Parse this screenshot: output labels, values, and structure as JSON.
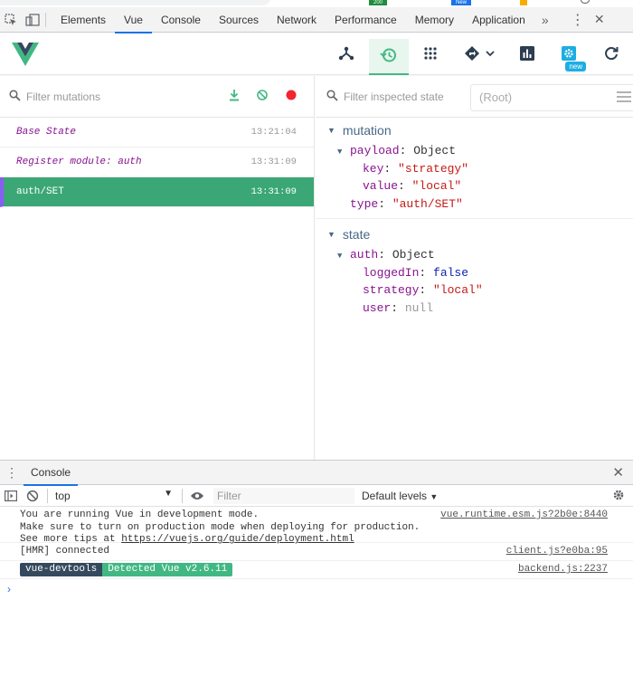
{
  "browser_badges": [
    "200",
    "New"
  ],
  "devtools": {
    "tabs": [
      {
        "label": "Elements",
        "active": false
      },
      {
        "label": "Vue",
        "active": true
      },
      {
        "label": "Console",
        "active": false
      },
      {
        "label": "Sources",
        "active": false
      },
      {
        "label": "Network",
        "active": false
      },
      {
        "label": "Performance",
        "active": false
      },
      {
        "label": "Memory",
        "active": false
      },
      {
        "label": "Application",
        "active": false
      }
    ],
    "more": "»",
    "kebab": "⋮",
    "close": "✕"
  },
  "vue_header": {
    "buttons": [
      {
        "icon": "components-tree-icon",
        "active": false
      },
      {
        "icon": "history-icon",
        "active": true
      },
      {
        "icon": "events-icon",
        "active": false
      },
      {
        "icon": "routing-icon",
        "active": false
      },
      {
        "icon": "performance-icon",
        "active": false
      },
      {
        "icon": "settings-icon",
        "active": false
      },
      {
        "icon": "refresh-icon",
        "active": false
      }
    ],
    "settings_badge": "new",
    "accent": "#42b983"
  },
  "mutations": {
    "filter_placeholder": "Filter mutations",
    "items": [
      {
        "name": "Base State",
        "time": "13:21:04",
        "selected": false
      },
      {
        "name": "Register module: auth",
        "time": "13:31:09",
        "selected": false
      },
      {
        "name": "auth/SET",
        "time": "13:31:09",
        "selected": true
      }
    ]
  },
  "inspector": {
    "filter_placeholder": "Filter inspected state",
    "root_label": "(Root)",
    "mutation_section": {
      "title": "mutation",
      "payload_key": "payload",
      "payload_type": "Object",
      "key_key": "key",
      "key_value": "\"strategy\"",
      "value_key": "value",
      "value_value": "\"local\"",
      "type_key": "type",
      "type_value": "\"auth/SET\""
    },
    "state_section": {
      "title": "state",
      "auth_key": "auth",
      "auth_type": "Object",
      "loggedIn_key": "loggedIn",
      "loggedIn_value": "false",
      "strategy_key": "strategy",
      "strategy_value": "\"local\"",
      "user_key": "user",
      "user_value": "null"
    }
  },
  "console": {
    "tab_label": "Console",
    "context": "top",
    "filter_placeholder": "Filter",
    "levels": "Default levels",
    "messages": [
      {
        "lines": [
          "You are running Vue in development mode.",
          "Make sure to turn on production mode when deploying for production.",
          "See more tips at "
        ],
        "link": "https://vuejs.org/guide/deployment.html",
        "source": "vue.runtime.esm.js?2b0e:8440"
      },
      {
        "text": "[HMR] connected",
        "source": "client.js?e0ba:95"
      },
      {
        "pill_left": "vue-devtools",
        "pill_right": "Detected Vue v2.6.11",
        "source": "backend.js:2237"
      }
    ],
    "prompt": "›"
  }
}
